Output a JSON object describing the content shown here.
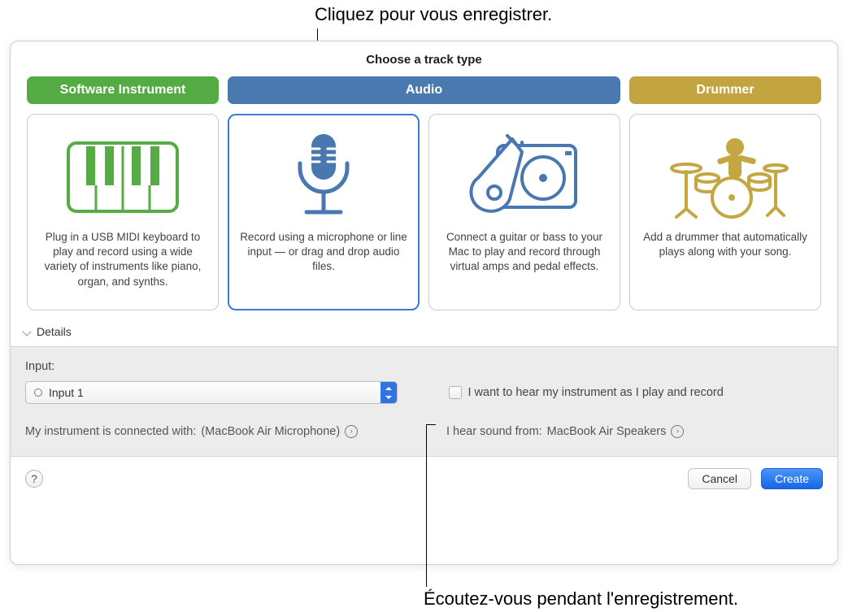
{
  "annotations": {
    "top": "Cliquez pour vous enregistrer.",
    "bottom": "Écoutez-vous pendant l'enregistrement."
  },
  "window": {
    "title": "Choose a track type",
    "tabs": {
      "software": "Software Instrument",
      "audio": "Audio",
      "drummer": "Drummer"
    },
    "cards": {
      "software": "Plug in a USB MIDI keyboard to play and record using a wide variety of instruments like piano, organ, and synths.",
      "mic": "Record using a microphone or line input — or drag and drop audio files.",
      "guitar": "Connect a guitar or bass to your Mac to play and record through virtual amps and pedal effects.",
      "drummer": "Add a drummer that automatically plays along with your song."
    },
    "details_label": "Details",
    "input_label": "Input:",
    "input_value": "Input 1",
    "monitor_label": "I want to hear my instrument as I play and record",
    "connected_prefix": "My instrument is connected with: ",
    "connected_device": "(MacBook Air Microphone)",
    "output_prefix": "I hear sound from: ",
    "output_device": "MacBook Air Speakers",
    "footer": {
      "cancel": "Cancel",
      "create": "Create"
    }
  }
}
